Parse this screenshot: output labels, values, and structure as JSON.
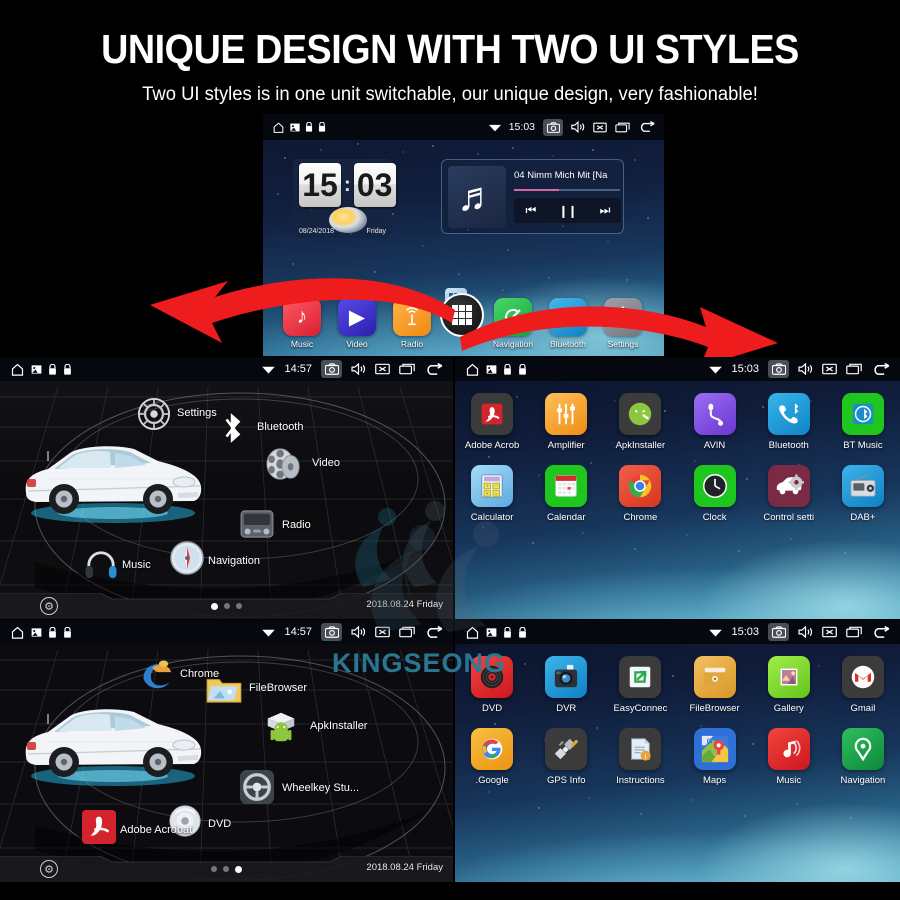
{
  "header": {
    "title": "UNIQUE DESIGN WITH TWO UI STYLES",
    "subtitle": "Two UI styles is in one unit switchable, our unique design, very fashionable!"
  },
  "watermark": {
    "text": "KINGSEONG",
    "color": "#2a7c9a"
  },
  "statusbar": {
    "home_icon": "home-icon",
    "image_icon": "image-icon",
    "lock_icon": "lock-icon",
    "wifi_icon": "wifi-icon",
    "camera_icon": "camera-icon",
    "volume_icon": "volume-icon",
    "mute_icon": "mute-x-icon",
    "recents_icon": "recents-icon",
    "back_icon": "back-icon",
    "time_top": "15:03",
    "time_left": "14:57",
    "time_right": "15:03"
  },
  "top_screen": {
    "clock_widget": {
      "hours": "15",
      "minutes": "03",
      "separator": ":",
      "date": "08/24/2018",
      "weekday": "Friday"
    },
    "music_widget": {
      "track": "04 Nimm Mich Mit [Na",
      "prev_icon": "previous-track-icon",
      "pause_icon": "pause-icon",
      "next_icon": "next-track-icon",
      "album_icon": "music-note-icon"
    },
    "dock": [
      {
        "label": "Music",
        "icon": "music-note-icon",
        "color": "#ea2f3f"
      },
      {
        "label": "Video",
        "icon": "video-play-icon",
        "color": "#3a2fc8"
      },
      {
        "label": "Radio",
        "icon": "radio-waves-icon",
        "color": "#f59a20"
      },
      {
        "label": "Navigation",
        "icon": "navigation-compass-icon",
        "color": "#22b44b"
      },
      {
        "label": "Bluetooth",
        "icon": "bluetooth-icon",
        "color": "#1c9ad6"
      },
      {
        "label": "Settings",
        "icon": "gear-icon",
        "color": "#8a8a92"
      }
    ],
    "drawer_button": "app-drawer-button"
  },
  "car_screen_1": {
    "nodes": [
      {
        "label": "Settings",
        "icon": "gear-icon"
      },
      {
        "label": "Bluetooth",
        "icon": "bluetooth-icon"
      },
      {
        "label": "Video",
        "icon": "film-reel-icon"
      },
      {
        "label": "Radio",
        "icon": "radio-icon"
      },
      {
        "label": "Navigation",
        "icon": "compass-icon"
      },
      {
        "label": "Music",
        "icon": "headphones-icon"
      }
    ],
    "page_dots": {
      "count": 3,
      "active": 0
    },
    "date": "2018.08.24  Friday",
    "android_button": "android-menu-button"
  },
  "car_screen_2": {
    "nodes": [
      {
        "label": "Chrome",
        "icon": "ie-edge-icon"
      },
      {
        "label": "FileBrowser",
        "icon": "folder-icon"
      },
      {
        "label": "ApkInstaller",
        "icon": "android-box-icon"
      },
      {
        "label": "Wheelkey Stu...",
        "icon": "steering-wheel-icon"
      },
      {
        "label": "DVD",
        "icon": "disc-icon"
      },
      {
        "label": "Adobe Acrobat",
        "icon": "pdf-icon"
      }
    ],
    "page_dots": {
      "count": 3,
      "active": 2
    },
    "date": "2018.08.24  Friday",
    "android_button": "android-menu-button"
  },
  "app_grid_1": {
    "apps": [
      {
        "label": "Adobe Acrob",
        "icon": "pdf-icon",
        "color": "#3b3b3b"
      },
      {
        "label": "Amplifier",
        "icon": "equalizer-icon",
        "color": "#f7a429"
      },
      {
        "label": "ApkInstaller",
        "icon": "android-icon",
        "color": "#3b3b3b"
      },
      {
        "label": "AVIN",
        "icon": "aux-plug-icon",
        "color": "#7b4ae0"
      },
      {
        "label": "Bluetooth",
        "icon": "phone-bluetooth-icon",
        "color": "#1b9ad8"
      },
      {
        "label": "BT Music",
        "icon": "bt-music-icon",
        "color": "#1ec61e"
      },
      {
        "label": "Calculator",
        "icon": "calculator-icon",
        "color": "#7ec8f2"
      },
      {
        "label": "Calendar",
        "icon": "calendar-icon",
        "color": "#1ec61e"
      },
      {
        "label": "Chrome",
        "icon": "chrome-icon",
        "color": "#e8452c"
      },
      {
        "label": "Clock",
        "icon": "clock-icon",
        "color": "#1ec61e"
      },
      {
        "label": "Control setti",
        "icon": "car-gear-icon",
        "color": "#7a2a44"
      },
      {
        "label": "DAB+",
        "icon": "radio-box-icon",
        "color": "#1b9ad8"
      }
    ]
  },
  "app_grid_2": {
    "apps": [
      {
        "label": "DVD",
        "icon": "vinyl-disc-icon",
        "color": "#e8242c"
      },
      {
        "label": "DVR",
        "icon": "camera-icon",
        "color": "#1b9ad8"
      },
      {
        "label": "EasyConnec",
        "icon": "easyconnect-icon",
        "color": "#3b3b3b"
      },
      {
        "label": "FileBrowser",
        "icon": "folder-icon",
        "color": "#e9a73a"
      },
      {
        "label": "Gallery",
        "icon": "gallery-photo-icon",
        "color": "#7ede2a"
      },
      {
        "label": "Gmail",
        "icon": "gmail-icon",
        "color": "#3b3b3b"
      },
      {
        "label": ".Google",
        "icon": "google-g-icon",
        "color": "#f5a623"
      },
      {
        "label": "GPS Info",
        "icon": "satellite-icon",
        "color": "#3b3b3b"
      },
      {
        "label": "Instructions",
        "icon": "document-info-icon",
        "color": "#3b3b3b"
      },
      {
        "label": "Maps",
        "icon": "maps-pin-icon",
        "color": "#2f6fd8"
      },
      {
        "label": "Music",
        "icon": "music-note-icon",
        "color": "#e8242c"
      },
      {
        "label": "Navigation",
        "icon": "navigation-pin-icon",
        "color": "#1d9e4a"
      }
    ]
  }
}
